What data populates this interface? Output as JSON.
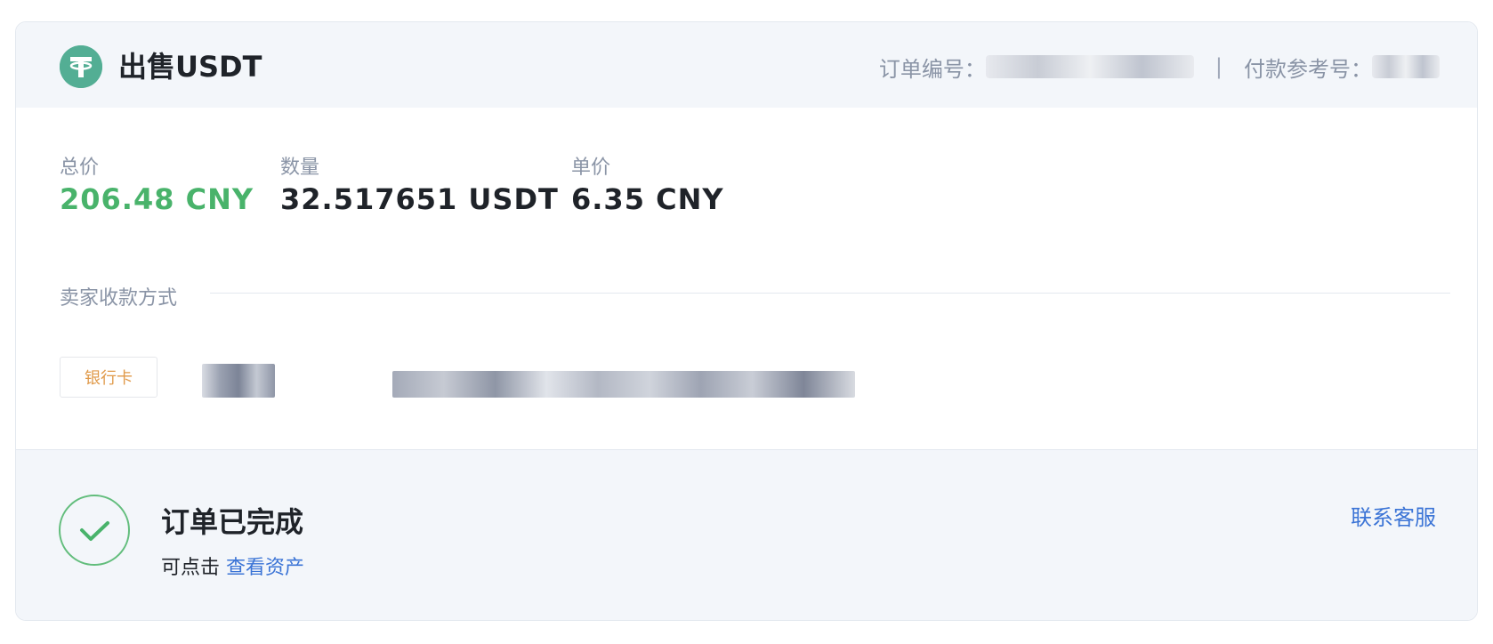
{
  "header": {
    "title": "出售USDT",
    "order_no_label": "订单编号：",
    "separator": "|",
    "payment_ref_label": "付款参考号："
  },
  "stats": {
    "total_label": "总价",
    "total_value": "206.48 CNY",
    "quantity_label": "数量",
    "quantity_value": "32.517651 USDT",
    "unit_price_label": "单价",
    "unit_price_value": "6.35 CNY"
  },
  "payment": {
    "section_label": "卖家收款方式",
    "method_badge": "银行卡"
  },
  "status": {
    "title": "订单已完成",
    "hint_prefix": "可点击",
    "view_assets_link": "查看资产",
    "contact_support": "联系客服"
  },
  "colors": {
    "accent_green": "#49b36b",
    "link_blue": "#3b74d6",
    "badge_orange": "#e09a4a",
    "tether_green": "#53ae94"
  }
}
